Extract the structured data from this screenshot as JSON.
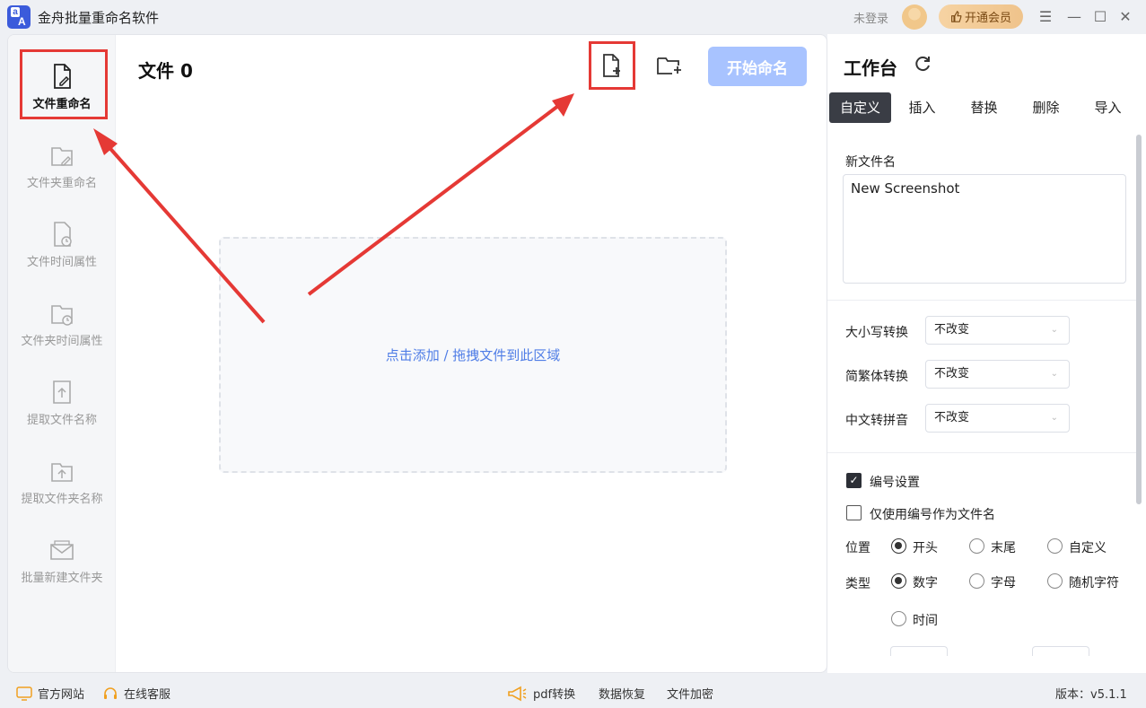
{
  "app": {
    "title": "金舟批量重命名软件",
    "login": "未登录",
    "vip_label": "开通会员",
    "logo_top": "a",
    "logo_bottom": "A"
  },
  "sidebar": {
    "items": [
      {
        "label": "文件重命名",
        "icon": "file-edit-icon",
        "active": true
      },
      {
        "label": "文件夹重命名",
        "icon": "folder-edit-icon",
        "active": false
      },
      {
        "label": "文件时间属性",
        "icon": "file-clock-icon",
        "active": false
      },
      {
        "label": "文件夹时间属性",
        "icon": "folder-clock-icon",
        "active": false
      },
      {
        "label": "提取文件名称",
        "icon": "file-upload-icon",
        "active": false
      },
      {
        "label": "提取文件夹名称",
        "icon": "folder-upload-icon",
        "active": false
      },
      {
        "label": "批量新建文件夹",
        "icon": "folder-mail-icon",
        "active": false
      }
    ]
  },
  "main": {
    "files_label": "文件 0",
    "start_button": "开始命名",
    "dropzone_text": "点击添加 / 拖拽文件到此区域"
  },
  "workbench": {
    "title": "工作台",
    "tabs": [
      "自定义",
      "插入",
      "替换",
      "删除",
      "导入"
    ],
    "active_tab": "自定义",
    "new_name_label": "新文件名",
    "new_name_value": "New Screenshot",
    "case_label": "大小写转换",
    "case_value": "不改变",
    "trad_label": "简繁体转换",
    "trad_value": "不改变",
    "pinyin_label": "中文转拼音",
    "pinyin_value": "不改变",
    "numbering_label": "编号设置",
    "numbering_checked": true,
    "only_number_label": "仅使用编号作为文件名",
    "only_number_checked": false,
    "position_label": "位置",
    "position_options": [
      "开头",
      "末尾",
      "自定义"
    ],
    "position_selected": "开头",
    "type_label": "类型",
    "type_options": [
      "数字",
      "字母",
      "随机字符",
      "时间"
    ],
    "type_selected": "数字"
  },
  "footer": {
    "website": "官方网站",
    "service": "在线客服",
    "pdf": "pdf转换",
    "recovery": "数据恢复",
    "encrypt": "文件加密",
    "version": "版本：v5.1.1"
  },
  "colors": {
    "accent": "#4f7de6",
    "start_button": "#a8c3ff",
    "highlight": "#e53935",
    "tab_active": "#3a3d45"
  }
}
